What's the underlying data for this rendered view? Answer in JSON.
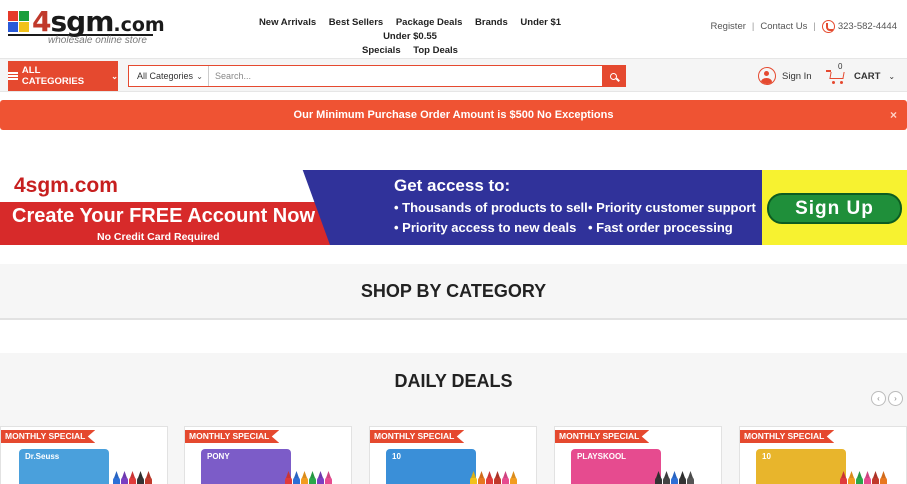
{
  "logo": {
    "brand_prefix": "4",
    "brand_main": "sgm",
    "brand_suffix": ".com",
    "tagline": "wholesale online store"
  },
  "topnav": [
    "New Arrivals",
    "Best Sellers",
    "Package Deals",
    "Brands",
    "Under $1",
    "Under $0.55",
    "Specials",
    "Top Deals"
  ],
  "toplinks": {
    "register": "Register",
    "contact": "Contact Us",
    "phone": "323-582-4444"
  },
  "searchbar": {
    "all_categories": "ALL CATEGORIES",
    "category_select": "All Categories",
    "placeholder": "Search...",
    "sign_in": "Sign In",
    "cart_label": "CART",
    "cart_count": "0"
  },
  "notice": {
    "text": "Our Minimum Purchase Order Amount is $500 No Exceptions",
    "close": "×"
  },
  "banner": {
    "brand": "4sgm.com",
    "headline": "Create Your FREE Account Now",
    "subline": "No Credit Card Required",
    "access_title": "Get access to:",
    "benefits_col1": [
      "• Thousands of products to sell",
      "• Priority access to new deals"
    ],
    "benefits_col2": [
      "• Priority customer support",
      "• Fast order processing"
    ],
    "cta": "Sign Up"
  },
  "sections": {
    "shop_by_category": "SHOP BY CATEGORY",
    "daily_deals": "DAILY DEALS"
  },
  "carousel": {
    "prev": "‹",
    "next": "›"
  },
  "products": [
    {
      "badge": "MONTHLY SPECIAL",
      "box_label": "Dr.Seuss",
      "box_color": "#4aa0dc"
    },
    {
      "badge": "MONTHLY SPECIAL",
      "box_label": "PONY",
      "box_color": "#7c5cc8"
    },
    {
      "badge": "MONTHLY SPECIAL",
      "box_label": "10",
      "box_color": "#3a8fd8"
    },
    {
      "badge": "MONTHLY SPECIAL",
      "box_label": "PLAYSKOOL",
      "box_color": "#e64b8f"
    },
    {
      "badge": "MONTHLY SPECIAL",
      "box_label": "10",
      "box_color": "#e8b52c"
    }
  ],
  "colors": {
    "accent": "#e5492f",
    "banner_blue": "#30329a",
    "banner_red": "#d72a2a",
    "banner_yellow": "#f7f230",
    "signup_green": "#1f8f3a"
  }
}
